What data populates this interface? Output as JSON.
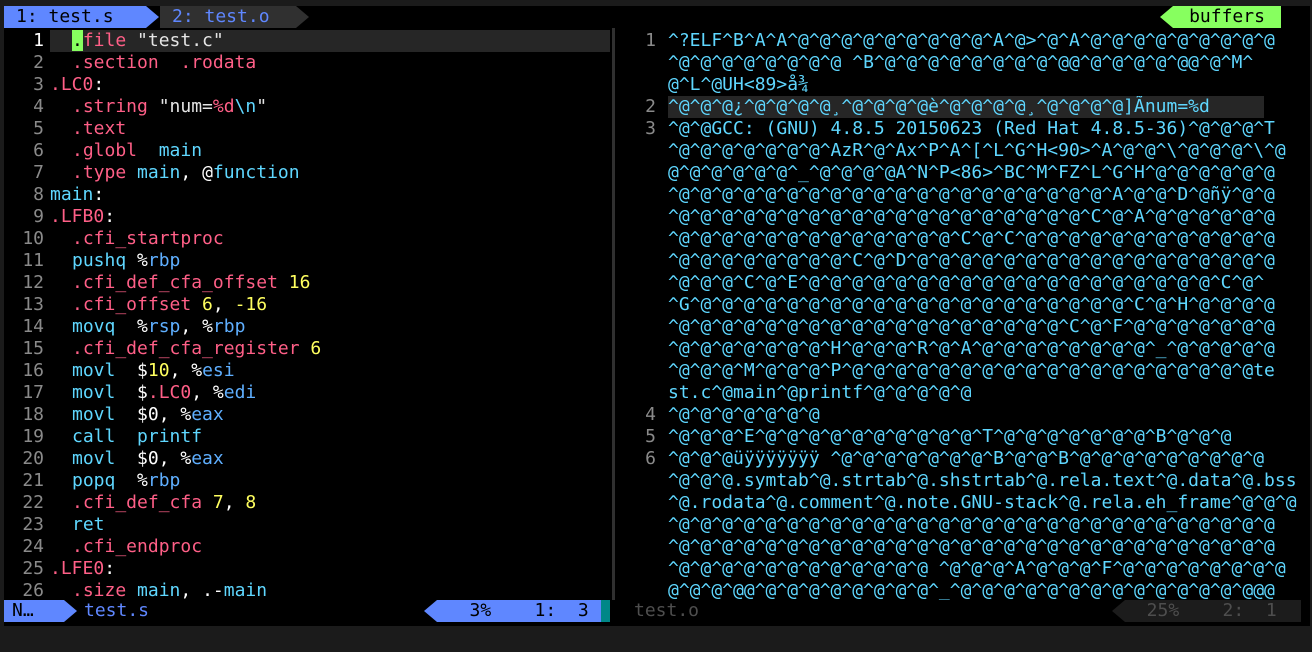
{
  "tabline": {
    "tab1": "1: test.s",
    "tab2": "2: test.o",
    "buffers": "buffers"
  },
  "left_pane": {
    "lines": [
      {
        "n": "1",
        "segs": [
          [
            "cursor",
            "."
          ],
          [
            "d",
            "file "
          ],
          [
            "s",
            "\"test.c\""
          ]
        ]
      },
      {
        "n": "2",
        "segs": [
          [
            "d",
            ".section  .rodata"
          ]
        ]
      },
      {
        "n": "3",
        "segs": [
          [
            "e",
            ".LC0"
          ],
          [
            "w",
            ":"
          ]
        ]
      },
      {
        "n": "4",
        "segs": [
          [
            "d",
            ".string "
          ],
          [
            "s",
            "\"num="
          ],
          [
            "e",
            "%d"
          ],
          [
            "k",
            "\\n"
          ],
          [
            "s",
            "\""
          ]
        ]
      },
      {
        "n": "5",
        "segs": [
          [
            "d",
            ".text"
          ]
        ]
      },
      {
        "n": "6",
        "segs": [
          [
            "d",
            ".globl  "
          ],
          [
            "k",
            "main"
          ]
        ]
      },
      {
        "n": "7",
        "segs": [
          [
            "d",
            ".type "
          ],
          [
            "k",
            "main"
          ],
          [
            "w",
            ", @"
          ],
          [
            "k",
            "function"
          ]
        ]
      },
      {
        "n": "8",
        "segs": [
          [
            "k",
            "main"
          ],
          [
            "w",
            ":"
          ]
        ]
      },
      {
        "n": "9",
        "segs": [
          [
            "e",
            ".LFB0"
          ],
          [
            "w",
            ":"
          ]
        ]
      },
      {
        "n": "10",
        "segs": [
          [
            "d",
            ".cfi_startproc"
          ]
        ]
      },
      {
        "n": "11",
        "segs": [
          [
            "k",
            "pushq "
          ],
          [
            "w",
            "%"
          ],
          [
            "r",
            "rbp"
          ]
        ]
      },
      {
        "n": "12",
        "segs": [
          [
            "d",
            ".cfi_def_cfa_offset "
          ],
          [
            "n",
            "16"
          ]
        ]
      },
      {
        "n": "13",
        "segs": [
          [
            "d",
            ".cfi_offset "
          ],
          [
            "n",
            "6"
          ],
          [
            "w",
            ", "
          ],
          [
            "n",
            "-16"
          ]
        ]
      },
      {
        "n": "14",
        "segs": [
          [
            "k",
            "movq  "
          ],
          [
            "w",
            "%"
          ],
          [
            "r",
            "rsp"
          ],
          [
            "w",
            ", %"
          ],
          [
            "r",
            "rbp"
          ]
        ]
      },
      {
        "n": "15",
        "segs": [
          [
            "d",
            ".cfi_def_cfa_register "
          ],
          [
            "n",
            "6"
          ]
        ]
      },
      {
        "n": "16",
        "segs": [
          [
            "k",
            "movl  "
          ],
          [
            "w",
            "$"
          ],
          [
            "n",
            "10"
          ],
          [
            "w",
            ", %"
          ],
          [
            "r",
            "esi"
          ]
        ]
      },
      {
        "n": "17",
        "segs": [
          [
            "k",
            "movl  "
          ],
          [
            "w",
            "$"
          ],
          [
            "e",
            ".LC0"
          ],
          [
            "w",
            ", %"
          ],
          [
            "r",
            "edi"
          ]
        ]
      },
      {
        "n": "18",
        "segs": [
          [
            "k",
            "movl  "
          ],
          [
            "w",
            "$0, %"
          ],
          [
            "r",
            "eax"
          ]
        ]
      },
      {
        "n": "19",
        "segs": [
          [
            "k",
            "call  printf"
          ]
        ]
      },
      {
        "n": "20",
        "segs": [
          [
            "k",
            "movl  "
          ],
          [
            "w",
            "$0, %"
          ],
          [
            "r",
            "eax"
          ]
        ]
      },
      {
        "n": "21",
        "segs": [
          [
            "k",
            "popq  "
          ],
          [
            "w",
            "%"
          ],
          [
            "r",
            "rbp"
          ]
        ]
      },
      {
        "n": "22",
        "segs": [
          [
            "d",
            ".cfi_def_cfa "
          ],
          [
            "n",
            "7"
          ],
          [
            "w",
            ", "
          ],
          [
            "n",
            "8"
          ]
        ]
      },
      {
        "n": "23",
        "segs": [
          [
            "k",
            "ret"
          ]
        ]
      },
      {
        "n": "24",
        "segs": [
          [
            "d",
            ".cfi_endproc"
          ]
        ]
      },
      {
        "n": "25",
        "segs": [
          [
            "e",
            ".LFE0"
          ],
          [
            "w",
            ":"
          ]
        ]
      },
      {
        "n": "26",
        "segs": [
          [
            "d",
            ".size "
          ],
          [
            "k",
            "main"
          ],
          [
            "w",
            ", .-"
          ],
          [
            "k",
            "main"
          ]
        ]
      }
    ],
    "indent": [
      "1",
      "2",
      "4",
      "5",
      "6",
      "7",
      "10",
      "11",
      "12",
      "13",
      "14",
      "15",
      "16",
      "17",
      "18",
      "19",
      "20",
      "21",
      "22",
      "23",
      "24",
      "26"
    ]
  },
  "right_pane": {
    "rows": [
      {
        "n": "1",
        "text": "^?ELF^B^A^A^@^@^@^@^@^@^@^@^@^A^@>^@^A^@^@^@^@^@^@^@^@^@"
      },
      {
        "n": "",
        "text": "^@^@^@^@^@^@^@^@ ^B^@^@^@^@^@^@^@^@^@@^@^@^@^@^@@^@^M^"
      },
      {
        "n": "",
        "text": "@^L^@UH<89>å¾"
      },
      {
        "n": "2",
        "text": "^@^@^@¿^@^@^@^@¸^@^@^@^@è^@^@^@^@¸^@^@^@^@]Ãnum=%d"
      },
      {
        "n": "3",
        "text": "^@^@GCC: (GNU) 4.8.5 20150623 (Red Hat 4.8.5-36)^@^@^@^T"
      },
      {
        "n": "",
        "text": "^@^@^@^@^@^@^@^AzR^@^Ax^P^A^[^L^G^H<90>^A^@^@^\\^@^@^@^\\^@"
      },
      {
        "n": "",
        "text": "@^@^@^@^@^@^_^@^@^@^@A^N^P<86>^BC^M^FZ^L^G^H^@^@^@^@^@^@"
      },
      {
        "n": "",
        "text": "^@^@^@^@^@^@^@^@^@^@^@^@^@^@^@^@^@^@^@^@^A^@^@^D^@ñÿ^@^@"
      },
      {
        "n": "",
        "text": "^@^@^@^@^@^@^@^@^@^@^@^@^@^@^@^@^@^@^@^C^@^A^@^@^@^@^@^@"
      },
      {
        "n": "",
        "text": "^@^@^@^@^@^@^@^@^@^@^@^@^@^C^@^C^@^@^@^@^@^@^@^@^@^@^@^@"
      },
      {
        "n": "",
        "text": "^@^@^@^@^@^@^@^@^C^@^D^@^@^@^@^@^@^@^@^@^@^@^@^@^@^@^@^@"
      },
      {
        "n": "",
        "text": "^@^@^@^C^@^E^@^@^@^@^@^@^@^@^@^@^@^@^@^@^@^@^@^@^@^C^@^"
      },
      {
        "n": "",
        "text": "^G^@^@^@^@^@^@^@^@^@^@^@^@^@^@^@^@^@^@^@^@^C^@^H^@^@^@^@"
      },
      {
        "n": "",
        "text": "^@^@^@^@^@^@^@^@^@^@^@^@^@^@^@^@^@^@^C^@^F^@^@^@^@^@^@^@"
      },
      {
        "n": "",
        "text": "^@^@^@^@^@^@^@^H^@^@^@^R^@^A^@^@^@^@^@^@^@^@^_^@^@^@^@^@"
      },
      {
        "n": "",
        "text": "^@^@^@^M^@^@^@^P^@^@^@^@^@^@^@^@^@^@^@^@^@^@^@^@^@^@^@te"
      },
      {
        "n": "",
        "text": "st.c^@main^@printf^@^@^@^@^@"
      },
      {
        "n": "4",
        "text": "^@^@^@^@^@^@^@"
      },
      {
        "n": "5",
        "text": "^@^@^@^E^@^@^@^@^@^@^@^@^@^@^T^@^@^@^@^@^@^@^B^@^@^@"
      },
      {
        "n": "6",
        "text": "^@^@^@üÿÿÿÿÿÿÿ ^@^@^@^@^@^@^@^B^@^@^B^@^@^@^@^@^@^@^@^@"
      },
      {
        "n": "",
        "text": "^@^@^@.symtab^@.strtab^@.shstrtab^@.rela.text^@.data^@.bss"
      },
      {
        "n": "",
        "text": "^@.rodata^@.comment^@.note.GNU-stack^@.rela.eh_frame^@^@^@"
      },
      {
        "n": "",
        "text": "^@^@^@^@^@^@^@^@^@^@^@^@^@^@^@^@^@^@^@^@^@^@^@^@^@^@^@^@"
      },
      {
        "n": "",
        "text": "^@^@^@^@^@^@^@^@^@^@^@^@^@^@^@^@^@^@^@^@^@^@^@^@^@^@^@^@"
      },
      {
        "n": "",
        "text": "^@^@^@^@^@^@^@^@^@^@^@^@ ^@^@^@^A^@^@^@^F^@^@^@^@^@^@^@^@"
      },
      {
        "n": "",
        "text": "@^@^@^@@^@^@^@^@^@^@^@^@^_^@^@^@^@^@^@^@^@^@^@^@^@^@^@@@"
      }
    ]
  },
  "statusline": {
    "mode": "N…",
    "left_file": "test.s",
    "left_pos": "   3%    1:  3",
    "right_file": "test.o",
    "right_pos": "  25%    2:  1"
  },
  "colors": {
    "accent_blue": "#5f87ff",
    "green": "#87ff5f",
    "directive_pink": "#ff5f87",
    "keyword_cyan": "#5fd7ff",
    "number_yellow": "#ffff5f"
  }
}
